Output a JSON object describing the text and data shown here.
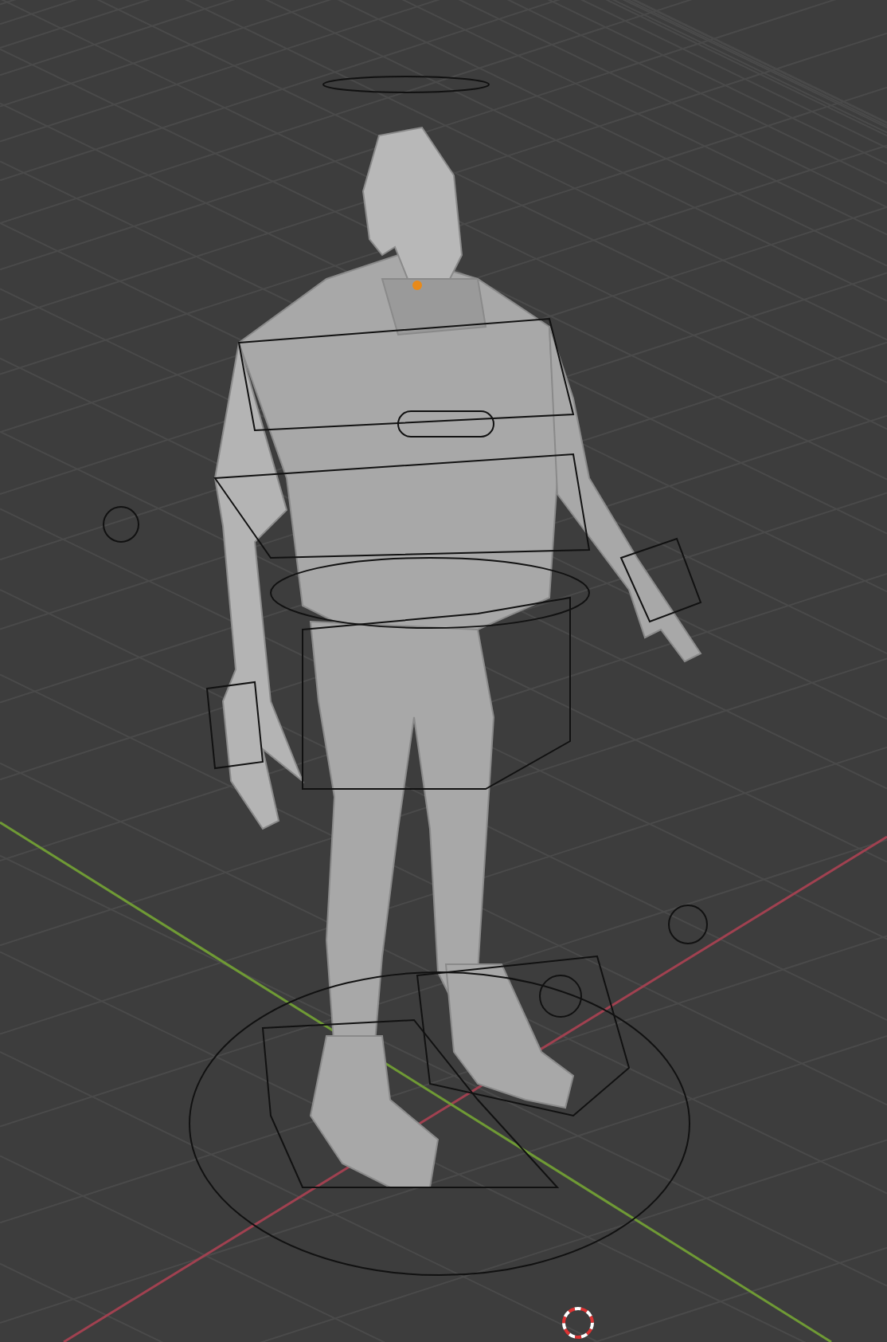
{
  "viewport": {
    "grid_visible": true,
    "axes_visible": true,
    "rig_visible": true,
    "cursor_visible": true
  }
}
